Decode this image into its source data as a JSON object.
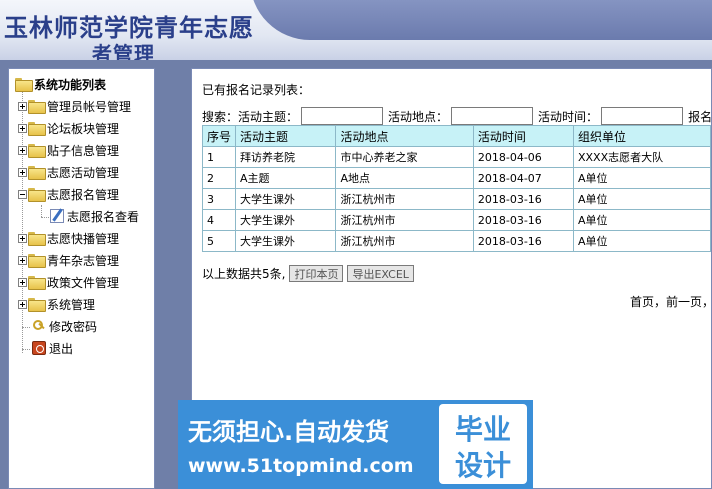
{
  "header": {
    "title": "玉林师范学院青年志愿",
    "subtitle": "者管理"
  },
  "sidebar": {
    "root": "系统功能列表",
    "items": [
      {
        "label": "管理员帐号管理",
        "icon": "folder-icon"
      },
      {
        "label": "论坛板块管理",
        "icon": "folder-icon"
      },
      {
        "label": "贴子信息管理",
        "icon": "folder-icon"
      },
      {
        "label": "志愿活动管理",
        "icon": "folder-icon"
      },
      {
        "label": "志愿报名管理",
        "icon": "folder-open-icon"
      },
      {
        "label": "志愿报名查看",
        "icon": "edit-document-icon"
      },
      {
        "label": "志愿快播管理",
        "icon": "folder-icon"
      },
      {
        "label": "青年杂志管理",
        "icon": "folder-icon"
      },
      {
        "label": "政策文件管理",
        "icon": "folder-icon"
      },
      {
        "label": "系统管理",
        "icon": "folder-icon"
      },
      {
        "label": "修改密码",
        "icon": "key-icon"
      },
      {
        "label": "退出",
        "icon": "exit-icon"
      }
    ]
  },
  "main": {
    "list_title": "已有报名记录列表：",
    "search": {
      "prefix": "搜索：",
      "topic_label": "活动主题：",
      "place_label": "活动地点：",
      "time_label": "活动时间：",
      "signup_label": "报名人"
    },
    "table": {
      "headers": [
        "序号",
        "活动主题",
        "活动地点",
        "活动时间",
        "组织单位"
      ],
      "rows": [
        [
          "1",
          "拜访养老院",
          "市中心养老之家",
          "2018-04-06",
          "XXXX志愿者大队"
        ],
        [
          "2",
          "A主题",
          "A地点",
          "2018-04-07",
          "A单位"
        ],
        [
          "3",
          "大学生课外",
          "浙江杭州市",
          "2018-03-16",
          "A单位"
        ],
        [
          "4",
          "大学生课外",
          "浙江杭州市",
          "2018-03-16",
          "A单位"
        ],
        [
          "5",
          "大学生课外",
          "浙江杭州市",
          "2018-03-16",
          "A单位"
        ]
      ]
    },
    "summary": "以上数据共5条,",
    "print_button": "打印本页",
    "export_button": "导出EXCEL",
    "pager": "首页，前一页，"
  },
  "watermark": {
    "line1": "无须担心.自动发货",
    "line2": "www.51topmind.com",
    "badge1": "毕业",
    "badge2": "设计"
  },
  "colors": {
    "table_header": "#c7f2f7",
    "title": "#2a3f8a",
    "watermark": "#3b8fd8"
  }
}
